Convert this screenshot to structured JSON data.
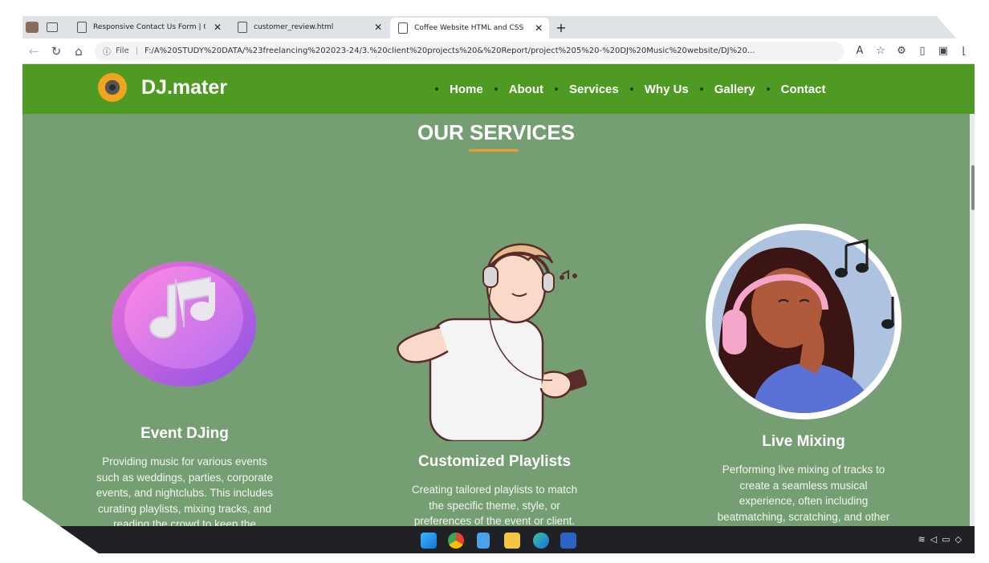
{
  "browser": {
    "tabs": [
      {
        "title": "Responsive Contact Us Form | Co",
        "active": false
      },
      {
        "title": "customer_review.html",
        "active": false
      },
      {
        "title": "Coffee Website HTML and CSS | ",
        "active": true
      }
    ],
    "new_tab_label": "+",
    "address": {
      "scheme_label": "File",
      "url": "F:/A%20STUDY%20DATA/%23freelancing%202023-24/3.%20client%20projects%20&%20Report/project%205%20-%20DJ%20Music%20website/DJ%20..."
    },
    "icons": [
      "back-icon",
      "reload-icon",
      "home-icon",
      "info-icon",
      "read-aloud-icon",
      "favorite-icon",
      "extensions-icon",
      "split-screen-icon",
      "collections-icon"
    ]
  },
  "site": {
    "brand": "DJ.mater",
    "nav": [
      "Home",
      "About",
      "Services",
      "Why Us",
      "Gallery",
      "Contact"
    ],
    "accent_color": "#4e9a23",
    "section_color": "#769e73",
    "underline_color": "#f29a2e"
  },
  "services": {
    "title": "OUR SERVICES",
    "items": [
      {
        "title": "Event DJing",
        "lines": [
          "Providing music for various events",
          "such as weddings, parties, corporate",
          "events, and nightclubs. This includes",
          "curating playlists, mixing tracks, and",
          "reading the crowd to keep the"
        ]
      },
      {
        "title": "Customized Playlists",
        "lines": [
          "Creating tailored playlists to match",
          "the specific theme, style, or",
          "preferences of the event or client."
        ]
      },
      {
        "title": "Live Mixing",
        "lines": [
          "Performing live mixing of tracks to",
          "create a seamless musical",
          "experience, often including",
          "beatmatching, scratching, and other"
        ]
      }
    ]
  },
  "taskbar": {
    "apps": [
      "windows-start-icon",
      "chrome-icon",
      "notepad-icon",
      "file-explorer-icon",
      "edge-icon",
      "word-icon"
    ],
    "tray": [
      "wifi-icon",
      "volume-icon",
      "battery-icon",
      "notification-icon"
    ]
  }
}
